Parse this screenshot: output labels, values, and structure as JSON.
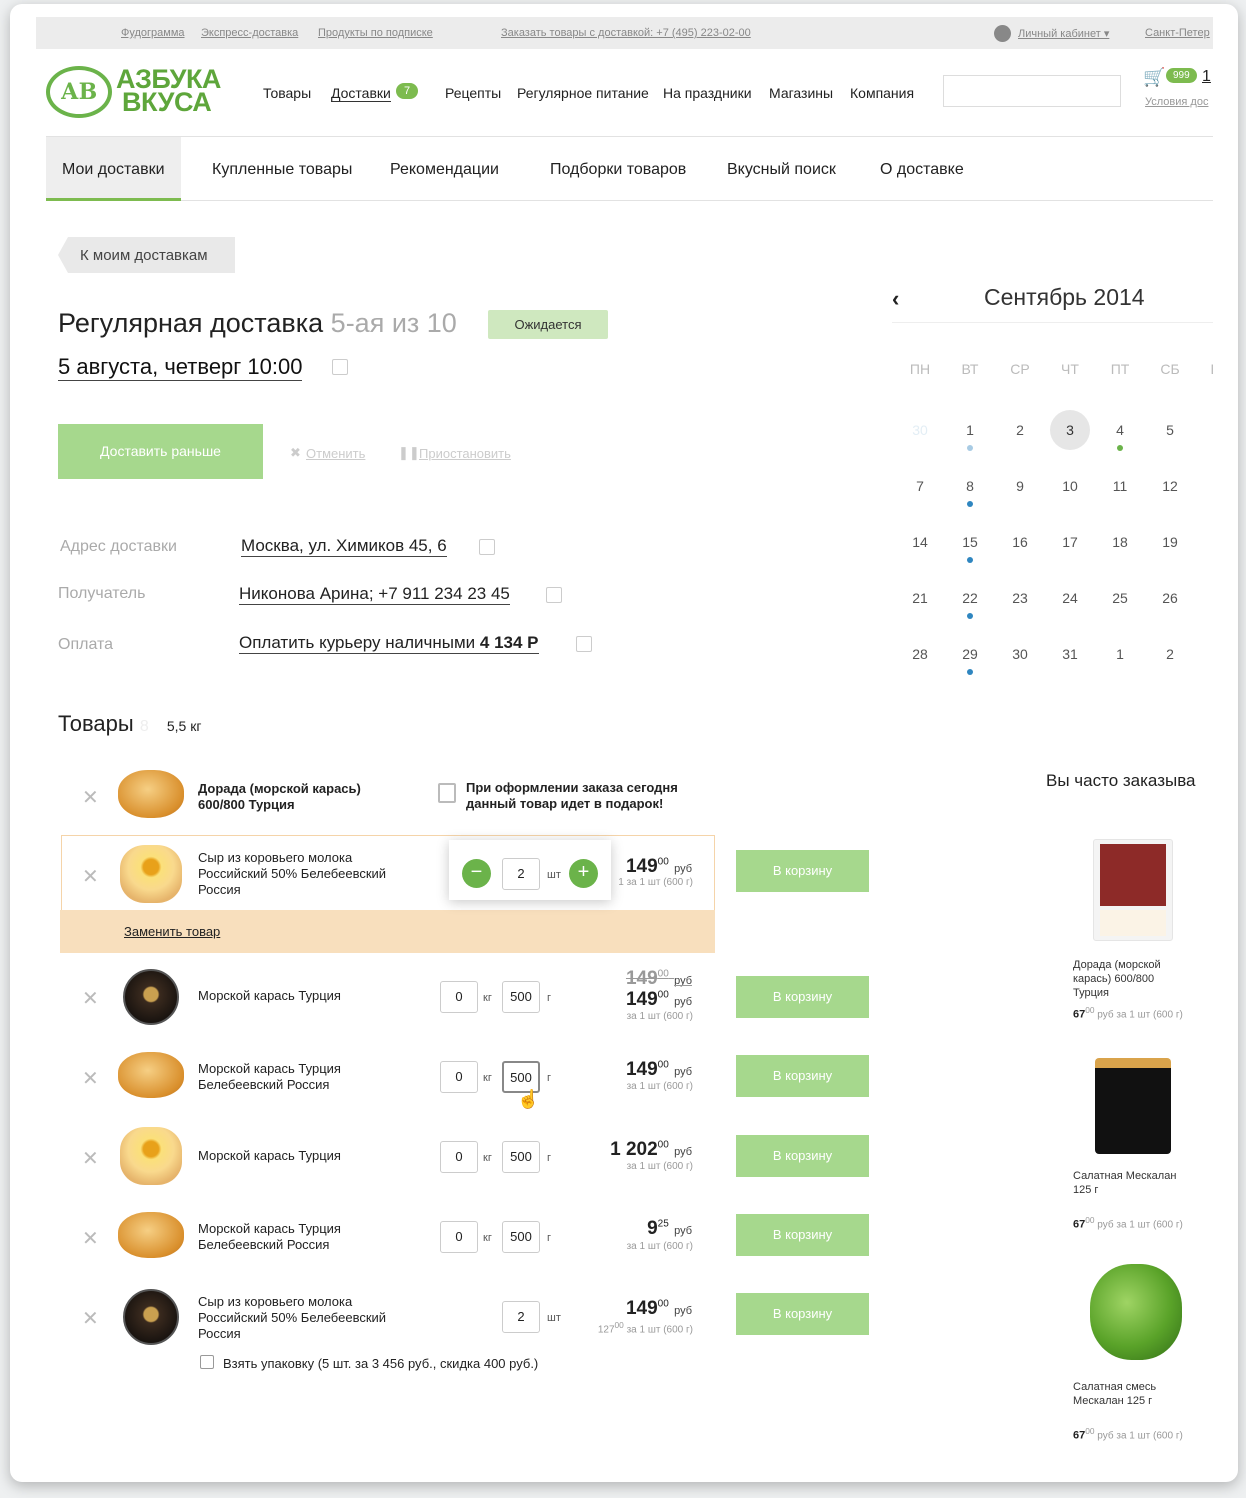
{
  "topbar": {
    "links": [
      "Фудограмма",
      "Экспресс-доставка",
      "Продукты по подписке"
    ],
    "order_phone": "Заказать товары с доставкой: +7 (495) 223-02-00",
    "account": "Личный кабинет ▾",
    "city": "Санкт-Петер"
  },
  "logo": {
    "mark": "АВ",
    "line1": "АЗБУКА",
    "line2": "ВКУСА"
  },
  "nav": {
    "items": [
      "Товары",
      "Доставки",
      "Рецепты",
      "Регулярное питание",
      "На праздники",
      "Магазины",
      "Компания"
    ],
    "deliveries_badge": "7"
  },
  "cart": {
    "count": "999",
    "num": "1",
    "terms": "Условия дос"
  },
  "tabs": [
    "Мои доставки",
    "Купленные товары",
    "Рекомендации",
    "Подборки товаров",
    "Вкусный поиск",
    "О доставке"
  ],
  "back_label": "К моим доставкам",
  "delivery": {
    "title": "Регулярная доставка",
    "subtitle": "5-ая из 10",
    "status": "Ожидается",
    "date": "5 августа, четверг  10:00",
    "deliver_earlier": "Доставить раньше",
    "cancel": "Отменить",
    "pause": "Приостановить"
  },
  "details": {
    "address_label": "Адрес доставки",
    "address": "Москва, ул. Химиков 45, 6",
    "recipient_label": "Получатель",
    "recipient": "Никонова Арина;  +7 911 234 23 45",
    "payment_label": "Оплата",
    "payment": "Оплатить курьеру наличными",
    "payment_sum": "4 134 Р"
  },
  "goods": {
    "title": "Товары",
    "count": "8",
    "weight": "5,5 кг",
    "gift_text": "При оформлении заказа сегодня данный товар идет в подарок!",
    "replace": "Заменить товар",
    "to_cart": "В корзину",
    "unit_pcs": "шт",
    "unit_kg": "кг",
    "unit_g": "г",
    "rub": "руб",
    "per_unit": "за 1 шт (600 г)",
    "pack_offer": "Взять упаковку (5 шт. за 3 456 руб., скидка 400 руб.)",
    "items": [
      {
        "name": "Дорада (морской карась) 600/800 Турция"
      },
      {
        "name": "Сыр из коровьего молока Российский 50% Белебеевский Россия",
        "qty": "2",
        "price": "149",
        "kop": "00",
        "note_prefix": "1"
      },
      {
        "name": "Морской карась Турция",
        "kg": "0",
        "g": "500",
        "old_price": "149",
        "old_kop": "00",
        "price": "149",
        "kop": "00"
      },
      {
        "name": "Морской карась Турция Белебеевский Россия",
        "kg": "0",
        "g": "500",
        "price": "149",
        "kop": "00"
      },
      {
        "name": "Морской карась Турция",
        "kg": "0",
        "g": "500",
        "price": "1 202",
        "kop": "00"
      },
      {
        "name": "Морской карась Турция Белебеевский Россия",
        "kg": "0",
        "g": "500",
        "price": "9",
        "kop": "25"
      },
      {
        "name": "Сыр из коровьего молока Российский 50% Белебеевский Россия",
        "qty": "2",
        "price": "149",
        "kop": "00",
        "old_small": "127",
        "old_small_kop": "00"
      }
    ]
  },
  "calendar": {
    "month": "Сентябрь 2014",
    "dow": [
      "ПН",
      "ВТ",
      "СР",
      "ЧТ",
      "ПТ",
      "СБ",
      "ВС"
    ],
    "weeks": [
      [
        "30",
        "1",
        "2",
        "3",
        "4",
        "5"
      ],
      [
        "7",
        "8",
        "9",
        "10",
        "11",
        "12"
      ],
      [
        "14",
        "15",
        "16",
        "17",
        "18",
        "19"
      ],
      [
        "21",
        "22",
        "23",
        "24",
        "25",
        "26"
      ],
      [
        "28",
        "29",
        "30",
        "31",
        "1",
        "2"
      ]
    ],
    "colors": {
      "dot_blue": "#2f86c0",
      "dot_light": "#a8cbe4",
      "dot_green": "#6bb34a"
    }
  },
  "recommend": {
    "title": "Вы часто заказыва",
    "items": [
      {
        "name": "Дорада (морской карась) 600/800 Турция",
        "price": "67",
        "kop": "00"
      },
      {
        "name": "Салатная Мескалан 125 г",
        "price": "67",
        "kop": "00"
      },
      {
        "name": "Салатная смесь Мескалан 125 г",
        "price": "67",
        "kop": "00"
      }
    ],
    "rub": "руб",
    "per_unit": "за 1 шт (600 г)"
  },
  "colors": {
    "brand_green": "#5ea63b",
    "button_green": "#a6d88d",
    "highlight": "#f8dfbd"
  }
}
